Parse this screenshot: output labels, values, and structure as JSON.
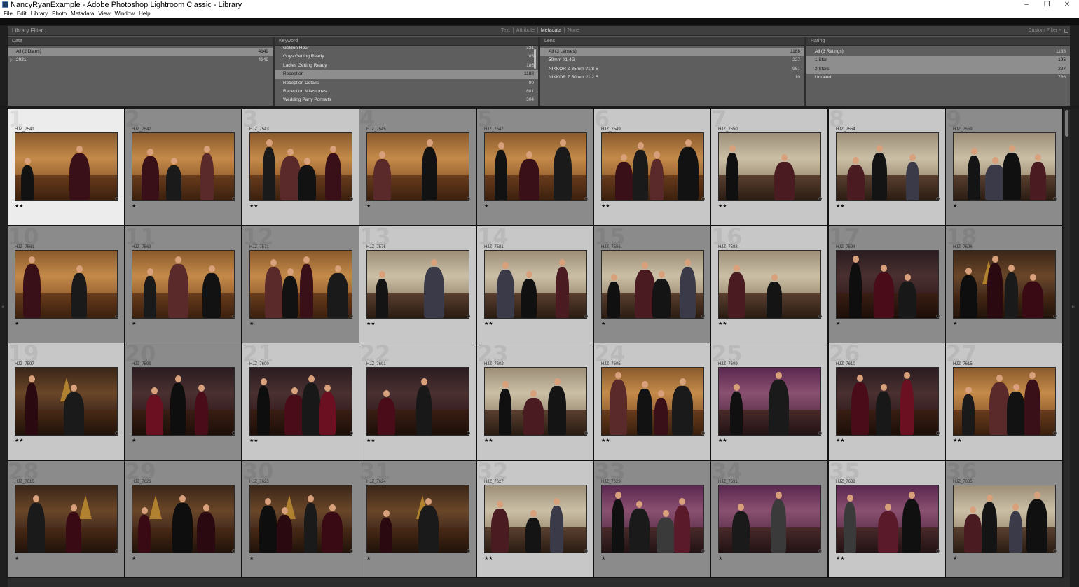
{
  "window": {
    "title": "NancyRyanExample - Adobe Photoshop Lightroom Classic - Library",
    "controls": [
      "–",
      "❐",
      "✕"
    ]
  },
  "menu": [
    "File",
    "Edit",
    "Library",
    "Photo",
    "Metadata",
    "View",
    "Window",
    "Help"
  ],
  "filter_bar": {
    "title": "Library Filter :",
    "modes": [
      {
        "label": "Text",
        "active": false
      },
      {
        "label": "Attribute",
        "active": false
      },
      {
        "label": "Metadata",
        "active": true
      },
      {
        "label": "None",
        "active": false
      }
    ],
    "preset": "Custom Filter ÷"
  },
  "filter_columns": [
    {
      "header": "Date",
      "rows": [
        {
          "label": "All (2 Dates)",
          "count": "4149",
          "selected": true,
          "expander": ""
        },
        {
          "label": "2021",
          "count": "4149",
          "selected": false,
          "expander": "▷"
        }
      ]
    },
    {
      "header": "Keyword",
      "rows": [
        {
          "label": "Golden Hour",
          "count": "321",
          "selected": false,
          "expander": ""
        },
        {
          "label": "Guys Getting Ready",
          "count": "85",
          "selected": false,
          "expander": ""
        },
        {
          "label": "Ladies Getting Ready",
          "count": "186",
          "selected": false,
          "expander": ""
        },
        {
          "label": "Reception",
          "count": "1188",
          "selected": true,
          "expander": ""
        },
        {
          "label": "Reception Details",
          "count": "80",
          "selected": false,
          "expander": ""
        },
        {
          "label": "Reception Milestones",
          "count": "801",
          "selected": false,
          "expander": ""
        },
        {
          "label": "Wedding Party Portraits",
          "count": "304",
          "selected": false,
          "expander": ""
        }
      ]
    },
    {
      "header": "Lens",
      "rows": [
        {
          "label": "All (3 Lenses)",
          "count": "1188",
          "selected": true,
          "expander": ""
        },
        {
          "label": "50mm f/1.4G",
          "count": "227",
          "selected": false,
          "expander": ""
        },
        {
          "label": "NIKKOR Z 35mm f/1.8 S",
          "count": "951",
          "selected": false,
          "expander": ""
        },
        {
          "label": "NIKKOR Z 50mm f/1.2 S",
          "count": "10",
          "selected": false,
          "expander": ""
        }
      ]
    },
    {
      "header": "Rating",
      "rows": [
        {
          "label": "All (3 Ratings)",
          "count": "1188",
          "selected": false,
          "expander": ""
        },
        {
          "label": "1 Star",
          "count": "195",
          "selected": true,
          "expander": ""
        },
        {
          "label": "2 Stars",
          "count": "227",
          "selected": true,
          "expander": ""
        },
        {
          "label": "Unrated",
          "count": "766",
          "selected": false,
          "expander": ""
        }
      ]
    }
  ],
  "photos": [
    {
      "num": "1",
      "name": "HJZ_7541",
      "stars": "★★",
      "tone": "white",
      "scene": "warm"
    },
    {
      "num": "2",
      "name": "HJZ_7542",
      "stars": "★",
      "tone": "gray",
      "scene": "warm"
    },
    {
      "num": "3",
      "name": "HJZ_7543",
      "stars": "★★",
      "tone": "light",
      "scene": "warm"
    },
    {
      "num": "4",
      "name": "HJZ_7545",
      "stars": "★",
      "tone": "gray",
      "scene": "warm"
    },
    {
      "num": "5",
      "name": "HJZ_7547",
      "stars": "★",
      "tone": "gray",
      "scene": "warm"
    },
    {
      "num": "6",
      "name": "HJZ_7549",
      "stars": "★★",
      "tone": "light",
      "scene": "warm"
    },
    {
      "num": "7",
      "name": "HJZ_7550",
      "stars": "★★",
      "tone": "light",
      "scene": "cool"
    },
    {
      "num": "8",
      "name": "HJZ_7554",
      "stars": "★★",
      "tone": "light",
      "scene": "cool"
    },
    {
      "num": "9",
      "name": "HJZ_7559",
      "stars": "★",
      "tone": "gray",
      "scene": "cool"
    },
    {
      "num": "10",
      "name": "HJZ_7561",
      "stars": "★",
      "tone": "gray",
      "scene": "warm"
    },
    {
      "num": "11",
      "name": "HJZ_7563",
      "stars": "★",
      "tone": "gray",
      "scene": "warm"
    },
    {
      "num": "12",
      "name": "HJZ_7571",
      "stars": "★",
      "tone": "gray",
      "scene": "warm"
    },
    {
      "num": "13",
      "name": "HJZ_7576",
      "stars": "★★",
      "tone": "light",
      "scene": "cool"
    },
    {
      "num": "14",
      "name": "HJZ_7581",
      "stars": "★★",
      "tone": "light",
      "scene": "cool"
    },
    {
      "num": "15",
      "name": "HJZ_7586",
      "stars": "★",
      "tone": "gray",
      "scene": "cool"
    },
    {
      "num": "16",
      "name": "HJZ_7588",
      "stars": "★★",
      "tone": "light",
      "scene": "cool"
    },
    {
      "num": "17",
      "name": "HJZ_7594",
      "stars": "★",
      "tone": "gray",
      "scene": "dark"
    },
    {
      "num": "18",
      "name": "HJZ_7596",
      "stars": "★",
      "tone": "gray",
      "scene": "tree"
    },
    {
      "num": "19",
      "name": "HJZ_7597",
      "stars": "★★",
      "tone": "light",
      "scene": "tree"
    },
    {
      "num": "20",
      "name": "HJZ_7599",
      "stars": "★",
      "tone": "gray",
      "scene": "dark"
    },
    {
      "num": "21",
      "name": "HJZ_7600",
      "stars": "★★",
      "tone": "light",
      "scene": "dark"
    },
    {
      "num": "22",
      "name": "HJZ_7601",
      "stars": "★★",
      "tone": "light",
      "scene": "dark"
    },
    {
      "num": "23",
      "name": "HJZ_7602",
      "stars": "★★",
      "tone": "light",
      "scene": "cool"
    },
    {
      "num": "24",
      "name": "HJZ_7605",
      "stars": "★★",
      "tone": "light",
      "scene": "warm"
    },
    {
      "num": "25",
      "name": "HJZ_7609",
      "stars": "★★",
      "tone": "light",
      "scene": "purple"
    },
    {
      "num": "26",
      "name": "HJZ_7610",
      "stars": "★★",
      "tone": "light",
      "scene": "dark"
    },
    {
      "num": "27",
      "name": "HJZ_7615",
      "stars": "★★",
      "tone": "light",
      "scene": "warm"
    },
    {
      "num": "28",
      "name": "HJZ_7616",
      "stars": "★",
      "tone": "gray",
      "scene": "tree"
    },
    {
      "num": "29",
      "name": "HJZ_7621",
      "stars": "★",
      "tone": "gray",
      "scene": "tree"
    },
    {
      "num": "30",
      "name": "HJZ_7623",
      "stars": "★",
      "tone": "gray",
      "scene": "tree"
    },
    {
      "num": "31",
      "name": "HJZ_7624",
      "stars": "★",
      "tone": "gray",
      "scene": "tree"
    },
    {
      "num": "32",
      "name": "HJZ_7627",
      "stars": "★★",
      "tone": "light",
      "scene": "cool"
    },
    {
      "num": "33",
      "name": "HJZ_7629",
      "stars": "★",
      "tone": "gray",
      "scene": "purple"
    },
    {
      "num": "34",
      "name": "HJZ_7631",
      "stars": "★",
      "tone": "gray",
      "scene": "purple"
    },
    {
      "num": "35",
      "name": "HJZ_7632",
      "stars": "★★",
      "tone": "light",
      "scene": "purple"
    },
    {
      "num": "36",
      "name": "HJZ_7635",
      "stars": "★",
      "tone": "gray",
      "scene": "cool"
    }
  ]
}
